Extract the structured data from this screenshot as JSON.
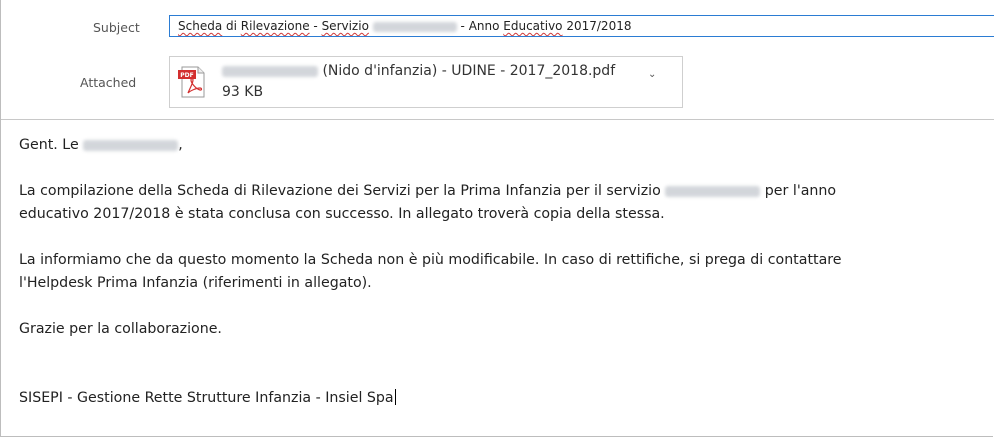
{
  "header": {
    "subject_label": "Subject",
    "attached_label": "Attached"
  },
  "subject": {
    "part1": "Scheda",
    "part2": " di ",
    "part3": "Rilevazione",
    "part4": " - ",
    "part5": "Servizio",
    "part6": " - Anno ",
    "part7": "Educativo",
    "part8": " 2017/2018"
  },
  "attachment": {
    "name_suffix": "(Nido d'infanzia) - UDINE - 2017_2018.pdf",
    "size": "93 KB",
    "icon": "pdf-icon",
    "icon_text": "PDF",
    "icon_color": "#d32f2f"
  },
  "body": {
    "greeting_prefix": "Gent. Le",
    "greeting_suffix": ",",
    "para1_line1_a": "La compilazione della Scheda di Rilevazione dei Servizi per la Prima Infanzia per il servizio",
    "para1_line1_b": "per l'anno",
    "para1_line2": "educativo 2017/2018 è stata conclusa con successo. In allegato troverà copia della stessa.",
    "para2_line1": "La informiamo che da questo momento la Scheda non è più modificabile. In caso di rettifiche, si prega di contattare",
    "para2_line2": "l'Helpdesk Prima Infanzia (riferimenti in allegato).",
    "thanks": "Grazie per la collaborazione.",
    "signature": "SISEPI - Gestione Rette Strutture Infanzia - Insiel Spa"
  }
}
